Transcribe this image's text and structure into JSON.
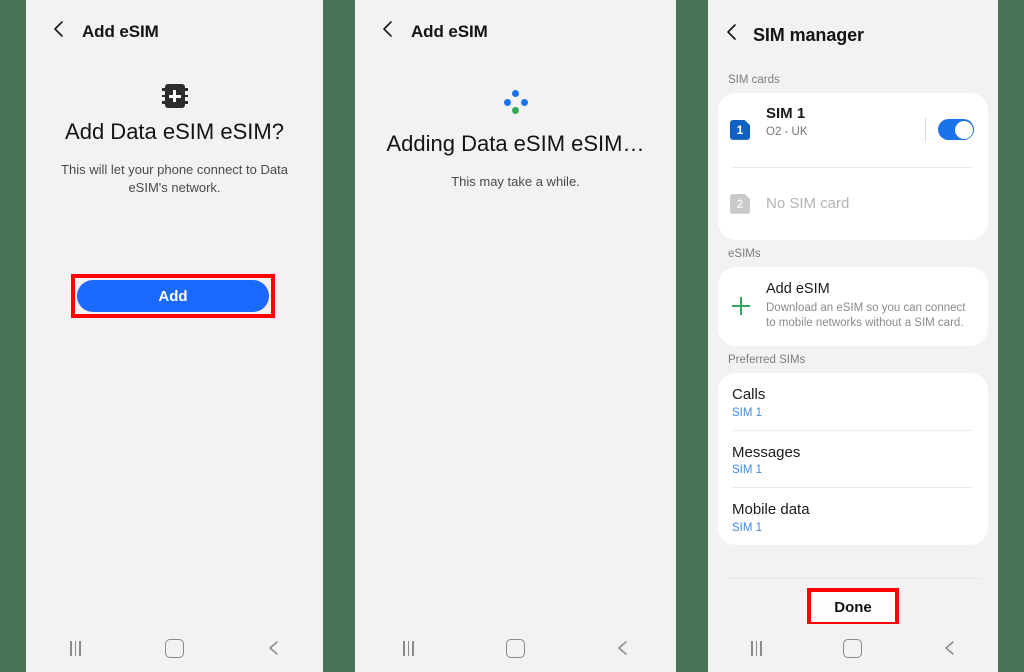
{
  "colors": {
    "gap_background": "#4a7254",
    "panel_background": "#f2f2f2",
    "primary_blue": "#1a6aff",
    "toggle_blue": "#1a73e8",
    "highlight_red": "#ff0000",
    "link_blue": "#3f8de0",
    "plus_green": "#2fa65e",
    "spinner_green": "#34a853"
  },
  "panels": [
    {
      "id": "add-esim-confirm",
      "app_bar": {
        "back_icon": "back-chevron-icon",
        "title": "Add eSIM"
      },
      "icon": "sim-chip-plus-icon",
      "title": "Add Data eSIM eSIM?",
      "subtitle": "This will let your phone connect to Data eSIM's network.",
      "primary_button": {
        "label": "Add",
        "highlighted": true
      }
    },
    {
      "id": "add-esim-progress",
      "app_bar": {
        "back_icon": "back-chevron-icon",
        "title": "Add eSIM"
      },
      "icon": "loading-dots-spinner-icon",
      "title": "Adding Data eSIM eSIM…",
      "subtitle": "This may take a while."
    },
    {
      "id": "sim-manager",
      "app_bar": {
        "back_icon": "back-chevron-icon",
        "title": "SIM manager"
      },
      "sections": {
        "sim_cards": {
          "label": "SIM cards",
          "rows": [
            {
              "badge": "1",
              "name": "SIM 1",
              "carrier": "O2 - UK",
              "redacted": true,
              "toggle_on": true,
              "state": "active"
            },
            {
              "badge": "2",
              "name": "No SIM card",
              "state": "empty"
            }
          ]
        },
        "esims": {
          "label": "eSIMs",
          "add_icon": "plus-icon",
          "title": "Add eSIM",
          "description": "Download an eSIM so you can connect to mobile networks without a SIM card."
        },
        "preferred_sims": {
          "label": "Preferred SIMs",
          "rows": [
            {
              "title": "Calls",
              "value": "SIM 1"
            },
            {
              "title": "Messages",
              "value": "SIM 1"
            },
            {
              "title": "Mobile data",
              "value": "SIM 1"
            }
          ]
        }
      },
      "done_button": {
        "label": "Done",
        "highlighted": true
      }
    }
  ],
  "nav_bar": {
    "recents_icon": "recents-icon",
    "home_icon": "home-icon",
    "back_icon": "back-chevron-icon"
  }
}
